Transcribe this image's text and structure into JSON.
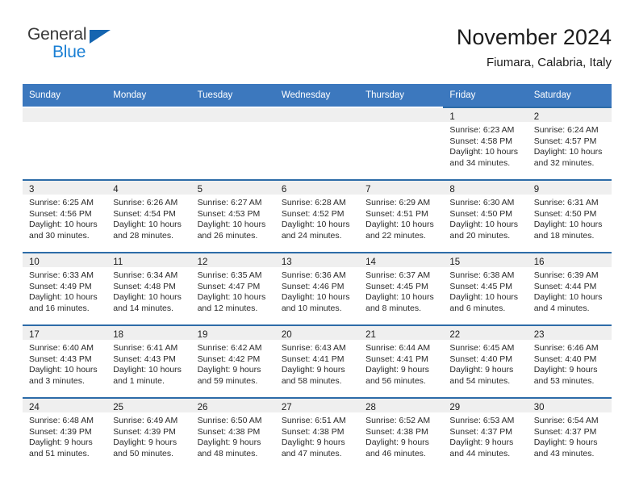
{
  "brand": {
    "name_top": "General",
    "name_bottom": "Blue",
    "triangle_color": "#1565b0",
    "blue_text_color": "#1a7fd4"
  },
  "header": {
    "title": "November 2024",
    "subtitle": "Fiumara, Calabria, Italy"
  },
  "theme": {
    "header_blue": "#3c78be",
    "cell_top_border": "#2d6ca8",
    "day_band_gray": "#efefef"
  },
  "weekday_headers": [
    "Sunday",
    "Monday",
    "Tuesday",
    "Wednesday",
    "Thursday",
    "Friday",
    "Saturday"
  ],
  "weeks": [
    [
      {
        "empty": true
      },
      {
        "empty": true
      },
      {
        "empty": true
      },
      {
        "empty": true
      },
      {
        "empty": true
      },
      {
        "day": "1",
        "sunrise": "Sunrise: 6:23 AM",
        "sunset": "Sunset: 4:58 PM",
        "daylight_1": "Daylight: 10 hours",
        "daylight_2": "and 34 minutes."
      },
      {
        "day": "2",
        "sunrise": "Sunrise: 6:24 AM",
        "sunset": "Sunset: 4:57 PM",
        "daylight_1": "Daylight: 10 hours",
        "daylight_2": "and 32 minutes."
      }
    ],
    [
      {
        "day": "3",
        "sunrise": "Sunrise: 6:25 AM",
        "sunset": "Sunset: 4:56 PM",
        "daylight_1": "Daylight: 10 hours",
        "daylight_2": "and 30 minutes."
      },
      {
        "day": "4",
        "sunrise": "Sunrise: 6:26 AM",
        "sunset": "Sunset: 4:54 PM",
        "daylight_1": "Daylight: 10 hours",
        "daylight_2": "and 28 minutes."
      },
      {
        "day": "5",
        "sunrise": "Sunrise: 6:27 AM",
        "sunset": "Sunset: 4:53 PM",
        "daylight_1": "Daylight: 10 hours",
        "daylight_2": "and 26 minutes."
      },
      {
        "day": "6",
        "sunrise": "Sunrise: 6:28 AM",
        "sunset": "Sunset: 4:52 PM",
        "daylight_1": "Daylight: 10 hours",
        "daylight_2": "and 24 minutes."
      },
      {
        "day": "7",
        "sunrise": "Sunrise: 6:29 AM",
        "sunset": "Sunset: 4:51 PM",
        "daylight_1": "Daylight: 10 hours",
        "daylight_2": "and 22 minutes."
      },
      {
        "day": "8",
        "sunrise": "Sunrise: 6:30 AM",
        "sunset": "Sunset: 4:50 PM",
        "daylight_1": "Daylight: 10 hours",
        "daylight_2": "and 20 minutes."
      },
      {
        "day": "9",
        "sunrise": "Sunrise: 6:31 AM",
        "sunset": "Sunset: 4:50 PM",
        "daylight_1": "Daylight: 10 hours",
        "daylight_2": "and 18 minutes."
      }
    ],
    [
      {
        "day": "10",
        "sunrise": "Sunrise: 6:33 AM",
        "sunset": "Sunset: 4:49 PM",
        "daylight_1": "Daylight: 10 hours",
        "daylight_2": "and 16 minutes."
      },
      {
        "day": "11",
        "sunrise": "Sunrise: 6:34 AM",
        "sunset": "Sunset: 4:48 PM",
        "daylight_1": "Daylight: 10 hours",
        "daylight_2": "and 14 minutes."
      },
      {
        "day": "12",
        "sunrise": "Sunrise: 6:35 AM",
        "sunset": "Sunset: 4:47 PM",
        "daylight_1": "Daylight: 10 hours",
        "daylight_2": "and 12 minutes."
      },
      {
        "day": "13",
        "sunrise": "Sunrise: 6:36 AM",
        "sunset": "Sunset: 4:46 PM",
        "daylight_1": "Daylight: 10 hours",
        "daylight_2": "and 10 minutes."
      },
      {
        "day": "14",
        "sunrise": "Sunrise: 6:37 AM",
        "sunset": "Sunset: 4:45 PM",
        "daylight_1": "Daylight: 10 hours",
        "daylight_2": "and 8 minutes."
      },
      {
        "day": "15",
        "sunrise": "Sunrise: 6:38 AM",
        "sunset": "Sunset: 4:45 PM",
        "daylight_1": "Daylight: 10 hours",
        "daylight_2": "and 6 minutes."
      },
      {
        "day": "16",
        "sunrise": "Sunrise: 6:39 AM",
        "sunset": "Sunset: 4:44 PM",
        "daylight_1": "Daylight: 10 hours",
        "daylight_2": "and 4 minutes."
      }
    ],
    [
      {
        "day": "17",
        "sunrise": "Sunrise: 6:40 AM",
        "sunset": "Sunset: 4:43 PM",
        "daylight_1": "Daylight: 10 hours",
        "daylight_2": "and 3 minutes."
      },
      {
        "day": "18",
        "sunrise": "Sunrise: 6:41 AM",
        "sunset": "Sunset: 4:43 PM",
        "daylight_1": "Daylight: 10 hours",
        "daylight_2": "and 1 minute."
      },
      {
        "day": "19",
        "sunrise": "Sunrise: 6:42 AM",
        "sunset": "Sunset: 4:42 PM",
        "daylight_1": "Daylight: 9 hours",
        "daylight_2": "and 59 minutes."
      },
      {
        "day": "20",
        "sunrise": "Sunrise: 6:43 AM",
        "sunset": "Sunset: 4:41 PM",
        "daylight_1": "Daylight: 9 hours",
        "daylight_2": "and 58 minutes."
      },
      {
        "day": "21",
        "sunrise": "Sunrise: 6:44 AM",
        "sunset": "Sunset: 4:41 PM",
        "daylight_1": "Daylight: 9 hours",
        "daylight_2": "and 56 minutes."
      },
      {
        "day": "22",
        "sunrise": "Sunrise: 6:45 AM",
        "sunset": "Sunset: 4:40 PM",
        "daylight_1": "Daylight: 9 hours",
        "daylight_2": "and 54 minutes."
      },
      {
        "day": "23",
        "sunrise": "Sunrise: 6:46 AM",
        "sunset": "Sunset: 4:40 PM",
        "daylight_1": "Daylight: 9 hours",
        "daylight_2": "and 53 minutes."
      }
    ],
    [
      {
        "day": "24",
        "sunrise": "Sunrise: 6:48 AM",
        "sunset": "Sunset: 4:39 PM",
        "daylight_1": "Daylight: 9 hours",
        "daylight_2": "and 51 minutes."
      },
      {
        "day": "25",
        "sunrise": "Sunrise: 6:49 AM",
        "sunset": "Sunset: 4:39 PM",
        "daylight_1": "Daylight: 9 hours",
        "daylight_2": "and 50 minutes."
      },
      {
        "day": "26",
        "sunrise": "Sunrise: 6:50 AM",
        "sunset": "Sunset: 4:38 PM",
        "daylight_1": "Daylight: 9 hours",
        "daylight_2": "and 48 minutes."
      },
      {
        "day": "27",
        "sunrise": "Sunrise: 6:51 AM",
        "sunset": "Sunset: 4:38 PM",
        "daylight_1": "Daylight: 9 hours",
        "daylight_2": "and 47 minutes."
      },
      {
        "day": "28",
        "sunrise": "Sunrise: 6:52 AM",
        "sunset": "Sunset: 4:38 PM",
        "daylight_1": "Daylight: 9 hours",
        "daylight_2": "and 46 minutes."
      },
      {
        "day": "29",
        "sunrise": "Sunrise: 6:53 AM",
        "sunset": "Sunset: 4:37 PM",
        "daylight_1": "Daylight: 9 hours",
        "daylight_2": "and 44 minutes."
      },
      {
        "day": "30",
        "sunrise": "Sunrise: 6:54 AM",
        "sunset": "Sunset: 4:37 PM",
        "daylight_1": "Daylight: 9 hours",
        "daylight_2": "and 43 minutes."
      }
    ]
  ]
}
